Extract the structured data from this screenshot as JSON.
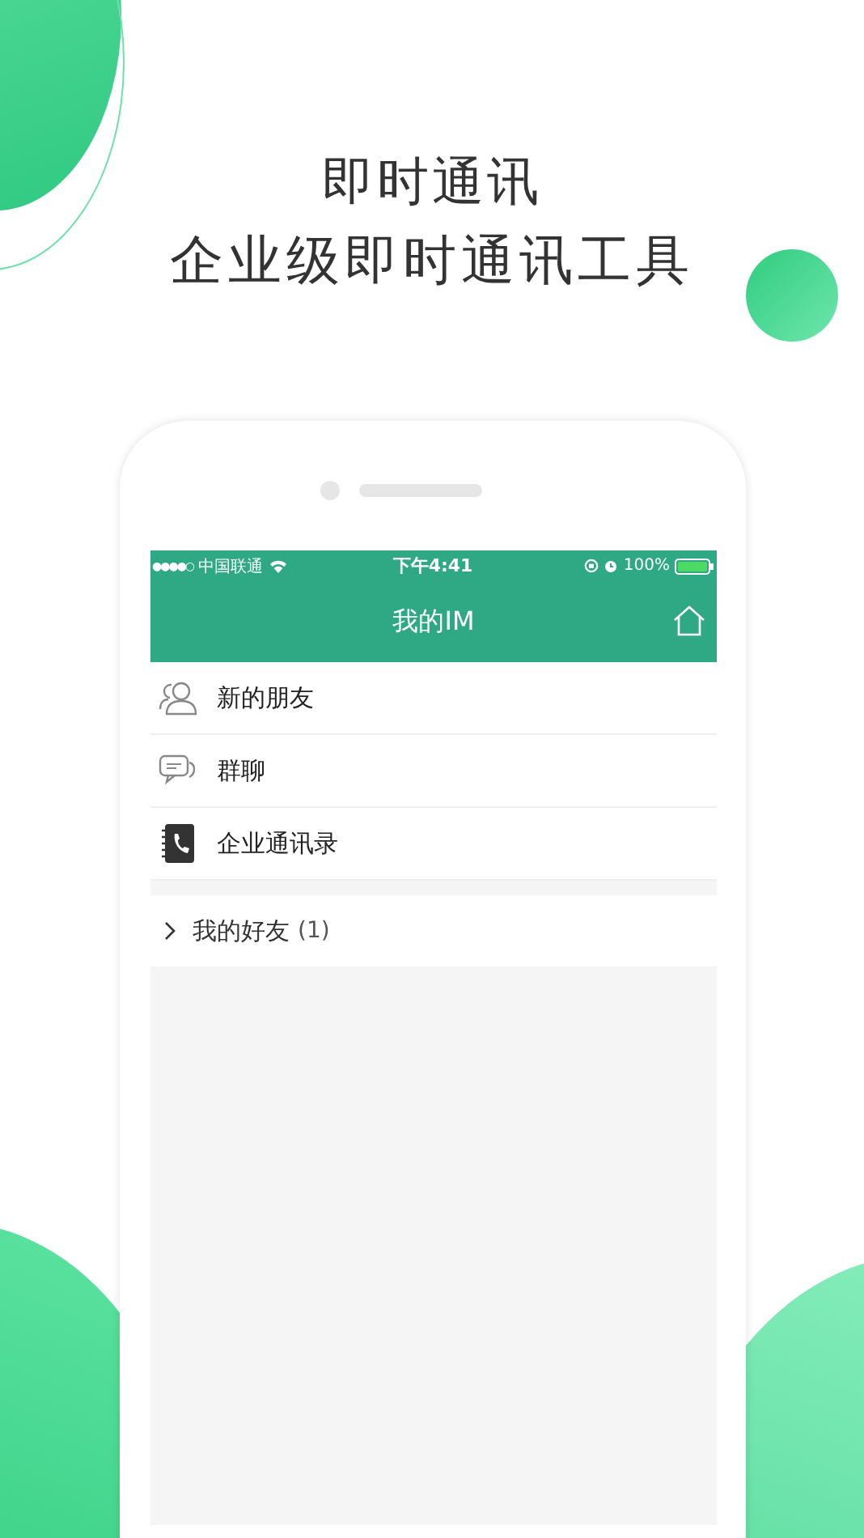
{
  "headline": {
    "title": "即时通讯",
    "subtitle": "企业级即时通讯工具"
  },
  "status_bar": {
    "signal_text": "●●●●○",
    "carrier": "中国联通",
    "time": "下午4:41",
    "battery": "100%"
  },
  "nav_bar": {
    "title": "我的IM"
  },
  "menu": [
    {
      "kind": "friends",
      "label": "新的朋友"
    },
    {
      "kind": "group",
      "label": "群聊"
    },
    {
      "kind": "directory",
      "label": "企业通讯录"
    }
  ],
  "friend_group": {
    "label": "我的好友",
    "count": "(1)",
    "expanded": false
  }
}
